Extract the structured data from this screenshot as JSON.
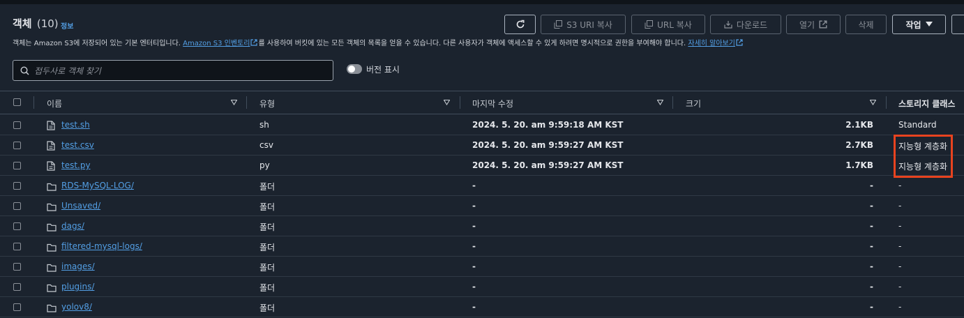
{
  "header": {
    "title": "객체",
    "count": "(10)",
    "info_link": "정보",
    "description": {
      "part1": "객체는 Amazon S3에 저장되어 있는 기본 엔터티입니다. ",
      "link1": "Amazon S3 인벤토리",
      "part2": "를 사용하여 버킷에 있는 모든 객체의 목록을 얻을 수 있습니다. 다른 사용자가 객체에 액세스할 수 있게 하려면 명시적으로 권한을 부여해야 합니다. ",
      "link2": "자세히 알아보기"
    }
  },
  "toolbar": {
    "s3_uri_copy": "S3 URI 복사",
    "url_copy": "URL 복사",
    "download": "다운로드",
    "open": "열기",
    "delete": "삭제",
    "actions": "작업"
  },
  "search": {
    "placeholder": "접두사로 객체 찾기"
  },
  "versions_toggle": {
    "label": "버전 표시",
    "on": false
  },
  "table": {
    "columns": {
      "name": "이름",
      "type": "유형",
      "modified": "마지막 수정",
      "size": "크기",
      "storage_class": "스토리지 클래스"
    },
    "rows": [
      {
        "name": "test.sh",
        "type": "sh",
        "modified": "2024. 5. 20. am 9:59:18 AM KST",
        "size": "2.1KB",
        "storage_class": "Standard"
      },
      {
        "name": "test.csv",
        "type": "csv",
        "modified": "2024. 5. 20. am 9:59:27 AM KST",
        "size": "2.7KB",
        "storage_class": "지능형 계층화"
      },
      {
        "name": "test.py",
        "type": "py",
        "modified": "2024. 5. 20. am 9:59:27 AM KST",
        "size": "1.7KB",
        "storage_class": "지능형 계층화"
      },
      {
        "name": "RDS-MySQL-LOG/",
        "type": "폴더",
        "modified": "-",
        "size": "-",
        "storage_class": "-"
      },
      {
        "name": "Unsaved/",
        "type": "폴더",
        "modified": "-",
        "size": "-",
        "storage_class": "-"
      },
      {
        "name": "dags/",
        "type": "폴더",
        "modified": "-",
        "size": "-",
        "storage_class": "-"
      },
      {
        "name": "filtered-mysql-logs/",
        "type": "폴더",
        "modified": "-",
        "size": "-",
        "storage_class": "-"
      },
      {
        "name": "images/",
        "type": "폴더",
        "modified": "-",
        "size": "-",
        "storage_class": "-"
      },
      {
        "name": "plugins/",
        "type": "폴더",
        "modified": "-",
        "size": "-",
        "storage_class": "-"
      },
      {
        "name": "yolov8/",
        "type": "폴더",
        "modified": "-",
        "size": "-",
        "storage_class": "-"
      }
    ]
  },
  "colors": {
    "link": "#539fe5",
    "background": "#1b232e",
    "highlight_border": "#e8431f"
  }
}
